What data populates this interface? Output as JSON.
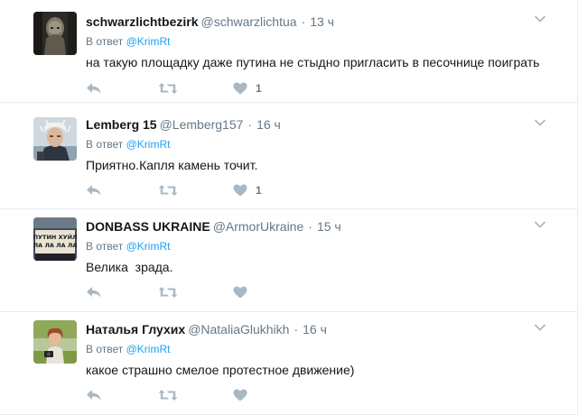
{
  "tweets": [
    {
      "name": "schwarzlichtbezirk",
      "handle": "@schwarzlichtua",
      "time": "13 ч",
      "reply_prefix": "В ответ",
      "reply_to": "@KrimRt",
      "text": "на такую площадку даже путина не стыдно пригласить в песочнице поиграть",
      "likes": "1",
      "avatar_colors": [
        "#2c2a26",
        "#7d7868"
      ]
    },
    {
      "name": "Lemberg 15",
      "handle": "@Lemberg157",
      "time": "16 ч",
      "reply_prefix": "В ответ",
      "reply_to": "@KrimRt",
      "text": "Приятно.Капля камень точит.",
      "likes": "1",
      "avatar_colors": [
        "#cfd8df",
        "#5b4a3b"
      ]
    },
    {
      "name": "DONBASS UKRAINE",
      "handle": "@ArmorUkraine",
      "time": "15 ч",
      "reply_prefix": "В ответ",
      "reply_to": "@KrimRt",
      "text": "Велика  зрада.",
      "likes": "",
      "avatar_text_1": "ПУТИН ХУЙЛ",
      "avatar_text_2": "ЛА ЛА ЛА ЛА",
      "avatar_colors": [
        "#3f4b58",
        "#e9e3d4"
      ]
    },
    {
      "name": "Наталья Глухих",
      "handle": "@NataliaGlukhikh",
      "time": "16 ч",
      "reply_prefix": "В ответ",
      "reply_to": "@KrimRt",
      "text": "какое страшно смелое протестное движение)",
      "likes": "",
      "avatar_colors": [
        "#7f9a45",
        "#e8e4da"
      ]
    }
  ],
  "colors": {
    "link": "#1da1f2",
    "secondary": "#657786",
    "icon": "#aab8c2",
    "divider": "#e6ecf0"
  },
  "icons": [
    "reply-icon",
    "retweet-icon",
    "heart-icon",
    "chevron-down-icon"
  ]
}
